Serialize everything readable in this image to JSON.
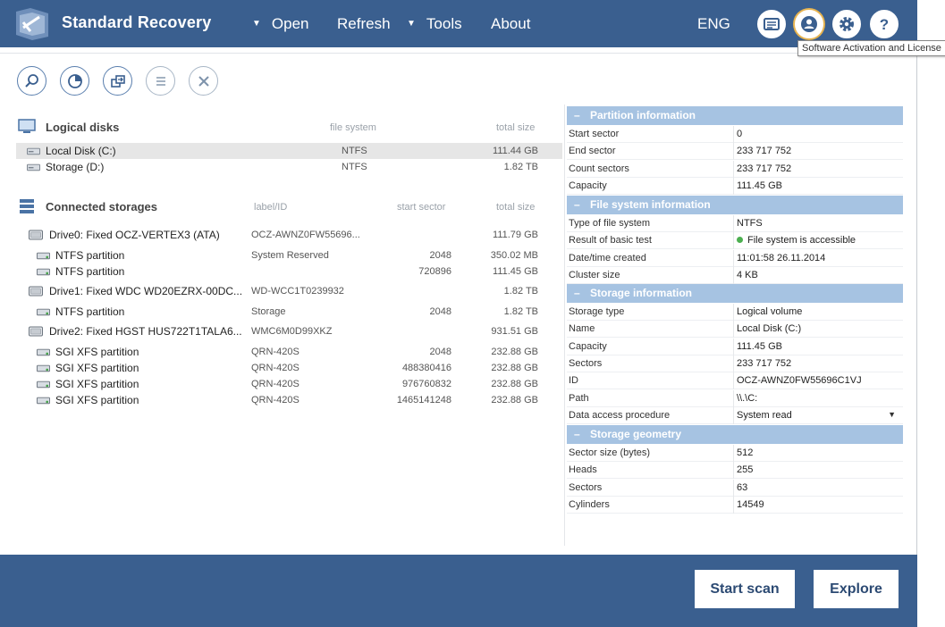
{
  "header": {
    "app_title": "Standard Recovery",
    "menu": [
      {
        "label": "Open",
        "has_caret": true
      },
      {
        "label": "Refresh",
        "has_caret": false
      },
      {
        "label": "Tools",
        "has_caret": true
      },
      {
        "label": "About",
        "has_caret": false
      }
    ],
    "language": "ENG",
    "icons": [
      "logs-icon",
      "user-icon",
      "gear-icon",
      "help-icon"
    ],
    "tooltip": "Software Activation and License"
  },
  "toolbar": {
    "buttons": [
      "search-icon",
      "chart-icon",
      "copy-icon",
      "list-icon",
      "close-icon"
    ]
  },
  "logical_disks": {
    "title": "Logical disks",
    "col_fs": "file system",
    "col_size": "total size",
    "items": [
      {
        "name": "Local Disk (C:)",
        "fs": "NTFS",
        "size": "111.44 GB",
        "selected": true
      },
      {
        "name": "Storage (D:)",
        "fs": "NTFS",
        "size": "1.82 TB",
        "selected": false
      }
    ]
  },
  "connected_storages": {
    "title": "Connected storages",
    "col_label": "label/ID",
    "col_start": "start sector",
    "col_size": "total size",
    "rows": [
      {
        "type": "drive",
        "name": "Drive0: Fixed OCZ-VERTEX3 (ATA)",
        "label": "OCZ-AWNZ0FW55696...",
        "start": "",
        "size": "111.79 GB"
      },
      {
        "type": "partition",
        "name": "NTFS partition",
        "label": "System Reserved",
        "start": "2048",
        "size": "350.02 MB"
      },
      {
        "type": "partition",
        "name": "NTFS partition",
        "label": "",
        "start": "720896",
        "size": "111.45 GB"
      },
      {
        "type": "drive",
        "name": "Drive1: Fixed WDC WD20EZRX-00DC...",
        "label": "WD-WCC1T0239932",
        "start": "",
        "size": "1.82 TB"
      },
      {
        "type": "partition",
        "name": "NTFS partition",
        "label": "Storage",
        "start": "2048",
        "size": "1.82 TB"
      },
      {
        "type": "drive",
        "name": "Drive2: Fixed HGST HUS722T1TALA6...",
        "label": "WMC6M0D99XKZ",
        "start": "",
        "size": "931.51 GB"
      },
      {
        "type": "partition",
        "name": "SGI XFS partition",
        "label": "QRN-420S",
        "start": "2048",
        "size": "232.88 GB"
      },
      {
        "type": "partition",
        "name": "SGI XFS partition",
        "label": "QRN-420S",
        "start": "488380416",
        "size": "232.88 GB"
      },
      {
        "type": "partition",
        "name": "SGI XFS partition",
        "label": "QRN-420S",
        "start": "976760832",
        "size": "232.88 GB"
      },
      {
        "type": "partition",
        "name": "SGI XFS partition",
        "label": "QRN-420S",
        "start": "1465141248",
        "size": "232.88 GB"
      }
    ]
  },
  "properties": {
    "sections": [
      {
        "title": "Partition information",
        "rows": [
          {
            "k": "Start sector",
            "v": "0"
          },
          {
            "k": "End sector",
            "v": "233 717 752"
          },
          {
            "k": "Count sectors",
            "v": "233 717 752"
          },
          {
            "k": "Capacity",
            "v": "111.45 GB"
          }
        ]
      },
      {
        "title": "File system information",
        "rows": [
          {
            "k": "Type of file system",
            "v": "NTFS"
          },
          {
            "k": "Result of basic test",
            "v": "File system is accessible",
            "status": "ok"
          },
          {
            "k": "Date/time created",
            "v": "11:01:58 26.11.2014"
          },
          {
            "k": "Cluster size",
            "v": "4 KB"
          }
        ]
      },
      {
        "title": "Storage information",
        "rows": [
          {
            "k": "Storage type",
            "v": "Logical volume"
          },
          {
            "k": "Name",
            "v": "Local Disk (C:)"
          },
          {
            "k": "Capacity",
            "v": "111.45 GB"
          },
          {
            "k": "Sectors",
            "v": "233 717 752"
          },
          {
            "k": "ID",
            "v": "OCZ-AWNZ0FW55696C1VJ"
          },
          {
            "k": "Path",
            "v": "\\\\.\\C:"
          },
          {
            "k": "Data access procedure",
            "v": "System read",
            "dropdown": true
          }
        ]
      },
      {
        "title": "Storage geometry",
        "rows": [
          {
            "k": "Sector size (bytes)",
            "v": "512"
          },
          {
            "k": "Heads",
            "v": "255"
          },
          {
            "k": "Sectors",
            "v": "63"
          },
          {
            "k": "Cylinders",
            "v": "14549"
          }
        ]
      }
    ]
  },
  "footer": {
    "start_scan": "Start scan",
    "explore": "Explore"
  },
  "colors": {
    "header_bg": "#3a5f8f",
    "section_bg": "#a6c3e2",
    "accent_ring": "#e7b450",
    "status_ok": "#4caf50"
  }
}
